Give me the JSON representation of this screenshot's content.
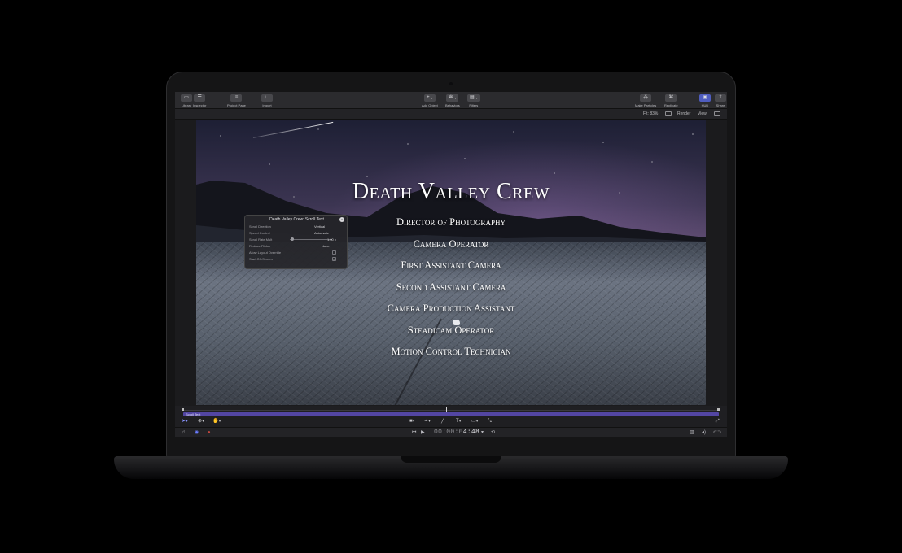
{
  "toolbar": {
    "left": [
      {
        "label": "Library",
        "icon": "library-icon"
      },
      {
        "label": "Inspector",
        "icon": "inspector-icon"
      },
      {
        "label": "Project Pane",
        "icon": "project-pane-icon"
      },
      {
        "label": "Import",
        "icon": "import-icon"
      }
    ],
    "center": [
      {
        "label": "Add Object",
        "icon": "plus-icon"
      },
      {
        "label": "Behaviors",
        "icon": "gear-icon"
      },
      {
        "label": "Filters",
        "icon": "filters-icon"
      }
    ],
    "right": [
      {
        "label": "Make Particles",
        "icon": "particles-icon"
      },
      {
        "label": "Replicate",
        "icon": "replicate-icon"
      },
      {
        "label": "HUD",
        "icon": "hud-icon"
      },
      {
        "label": "Share",
        "icon": "share-icon"
      }
    ]
  },
  "viewbar": {
    "fit": "Fit: 83%",
    "render": "Render",
    "view": "View"
  },
  "credits": {
    "title": "Death Valley Crew",
    "roles": [
      "Director of Photography",
      "Camera Operator",
      "First Assistant Camera",
      "Second Assistant Camera",
      "Camera Production Assistant",
      "Steadicam Operator",
      "Motion Control Technician"
    ]
  },
  "hud": {
    "title": "Death Valley Crew: Scroll Text",
    "rows": {
      "scroll_direction": {
        "label": "Scroll Direction",
        "value": "Vertical"
      },
      "speed_control": {
        "label": "Speed Control",
        "value": "Automatic"
      },
      "scroll_rate_mult": {
        "label": "Scroll Rate Mult",
        "value": "1.00 x"
      },
      "reduce_flicker": {
        "label": "Reduce Flicker",
        "value": "None"
      },
      "allow_layout_override": {
        "label": "Allow Layout Override",
        "checked": false
      },
      "start_off_screen": {
        "label": "Start Off-Screen",
        "checked": true
      }
    }
  },
  "timeline": {
    "track_label": "Scroll Text"
  },
  "transport": {
    "timecode_dim": "00:00:0",
    "timecode_bright": "4:48"
  },
  "colors": {
    "accent": "#5346a3",
    "hud_active": "#4f5dbf"
  }
}
